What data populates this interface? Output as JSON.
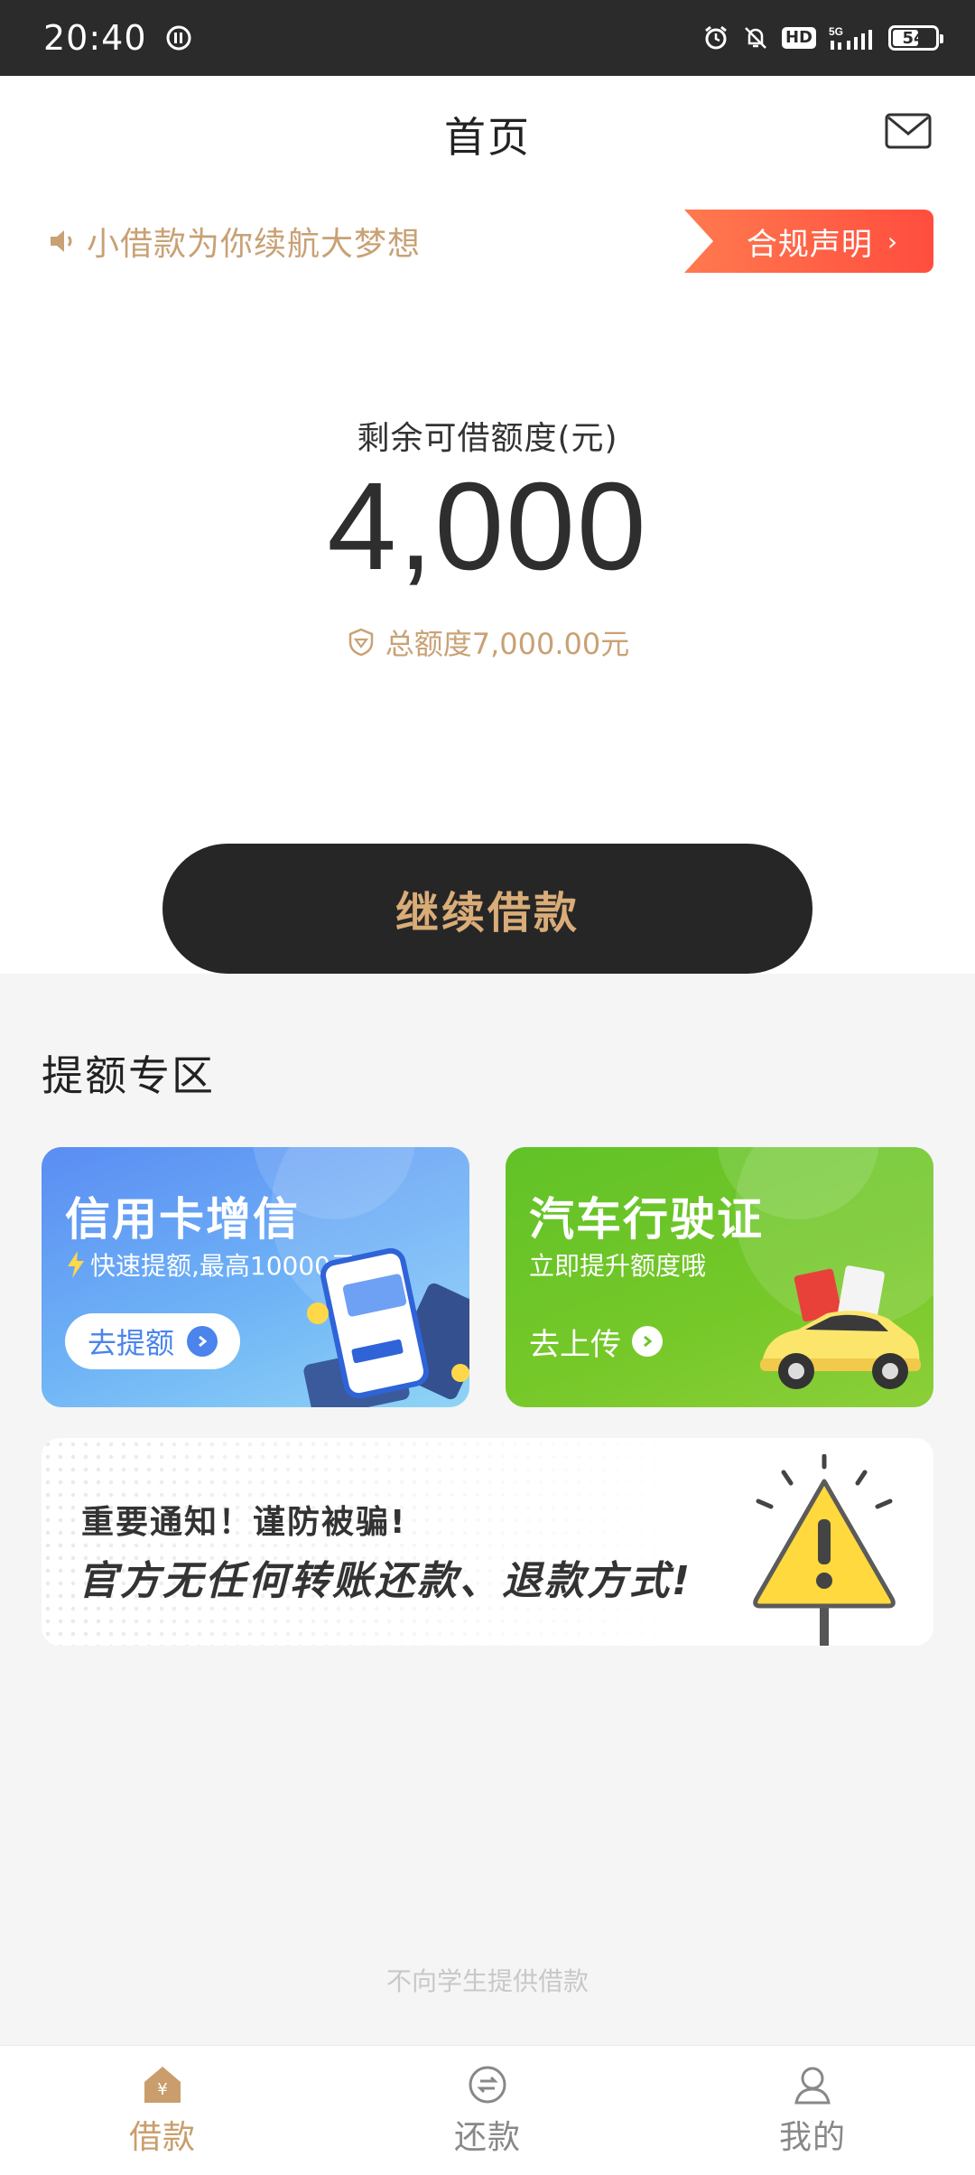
{
  "status_bar": {
    "time": "20:40",
    "network": "5G",
    "hd": "HD",
    "battery": "54"
  },
  "header": {
    "title": "首页"
  },
  "notice": {
    "text": "小借款为你续航大梦想",
    "compliance_label": "合规声明",
    "compliance_chevron": "›"
  },
  "credit": {
    "label": "剩余可借额度(元)",
    "amount": "4,000",
    "total": "总额度7,000.00元"
  },
  "borrow_button": {
    "label": "继续借款"
  },
  "boost_section": {
    "title": "提额专区",
    "cards": [
      {
        "title": "信用卡增信",
        "subtitle": "快速提额,最高10000元",
        "action": "去提额"
      },
      {
        "title": "汽车行驶证",
        "subtitle": "立即提升额度哦",
        "action": "去上传"
      }
    ]
  },
  "warning": {
    "line1": "重要通知！谨防被骗!",
    "line2": "官方无任何转账还款、退款方式!"
  },
  "footer_note": "不向学生提供借款",
  "bottom_nav": {
    "items": [
      {
        "label": "借款",
        "active": true
      },
      {
        "label": "还款",
        "active": false
      },
      {
        "label": "我的",
        "active": false
      }
    ]
  },
  "colors": {
    "accent_gold": "#c9a175",
    "button_dark": "#262626",
    "compliance_red": "#ff4d3e"
  }
}
